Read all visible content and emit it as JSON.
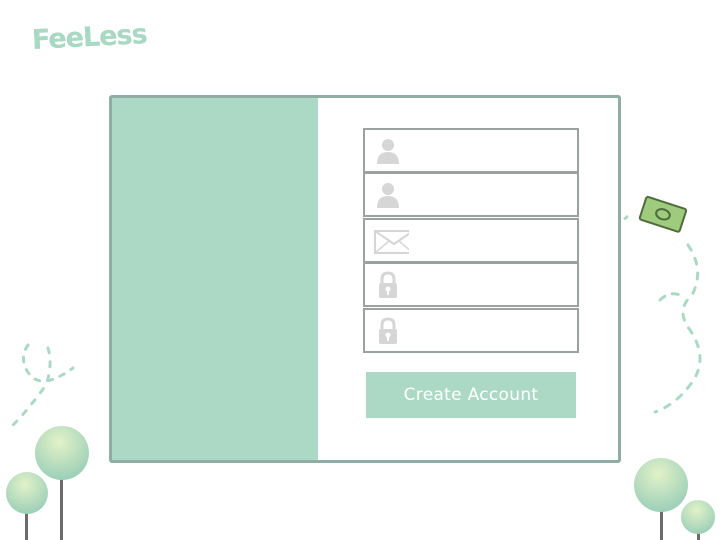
{
  "brand": {
    "logo_text": "FeeLess"
  },
  "form": {
    "fields": [
      {
        "name": "first-name",
        "icon": "user-icon",
        "value": "",
        "placeholder": ""
      },
      {
        "name": "last-name",
        "icon": "user-icon",
        "value": "",
        "placeholder": ""
      },
      {
        "name": "email",
        "icon": "envelope-icon",
        "value": "",
        "placeholder": ""
      },
      {
        "name": "password",
        "icon": "lock-icon",
        "value": "",
        "placeholder": ""
      },
      {
        "name": "confirm-password",
        "icon": "lock-icon",
        "value": "",
        "placeholder": ""
      }
    ],
    "submit_label": "Create Account"
  },
  "colors": {
    "accent": "#acd9c5",
    "border": "#8fada2",
    "icon": "#d6d6d6",
    "tree_top": "#d3ecc0",
    "tree_bottom": "#9ccfb8",
    "trunk": "#6b6b6b",
    "money": "#9ecb7c"
  }
}
